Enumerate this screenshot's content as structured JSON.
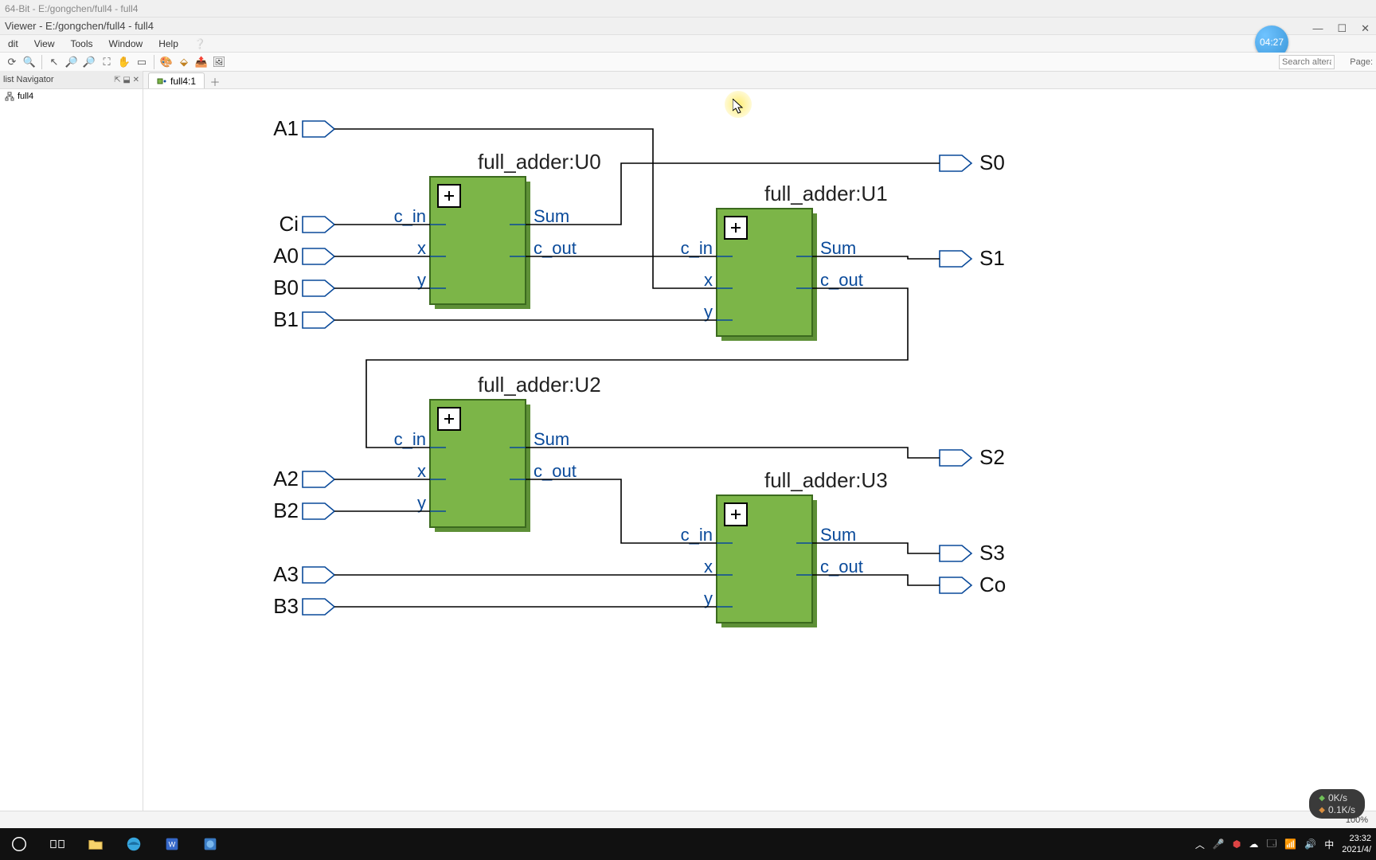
{
  "title1": "64-Bit - E:/gongchen/full4 - full4",
  "title2": "Viewer - E:/gongchen/full4 - full4",
  "menu": {
    "edit": "dit",
    "view": "View",
    "tools": "Tools",
    "window": "Window",
    "help": "Help"
  },
  "search_placeholder": "Search altera.",
  "page_label": "Page:",
  "timer": "04:27",
  "sidepanel_title": "list Navigator",
  "sidepanel_ctrls": "⇱ ⬓ ✕",
  "tree_root": "full4",
  "tab_active": "full4:1",
  "zoom": "100%",
  "netspeed_up": "0K/s",
  "netspeed_down": "0.1K/s",
  "ime": "中",
  "clock_time": "23:32",
  "clock_date": "2021/4/",
  "diagram": {
    "inputs": [
      "A1",
      "Ci",
      "A0",
      "B0",
      "B1",
      "A2",
      "B2",
      "A3",
      "B3"
    ],
    "outputs": [
      "S0",
      "S1",
      "S2",
      "S3",
      "Co"
    ],
    "blocks": [
      {
        "name": "full_adder:U0",
        "ports_left": [
          "c_in",
          "x",
          "y"
        ],
        "ports_right": [
          "Sum",
          "c_out"
        ]
      },
      {
        "name": "full_adder:U1",
        "ports_left": [
          "c_in",
          "x",
          "y"
        ],
        "ports_right": [
          "Sum",
          "c_out"
        ]
      },
      {
        "name": "full_adder:U2",
        "ports_left": [
          "c_in",
          "x",
          "y"
        ],
        "ports_right": [
          "Sum",
          "c_out"
        ]
      },
      {
        "name": "full_adder:U3",
        "ports_left": [
          "c_in",
          "x",
          "y"
        ],
        "ports_right": [
          "Sum",
          "c_out"
        ]
      }
    ]
  }
}
